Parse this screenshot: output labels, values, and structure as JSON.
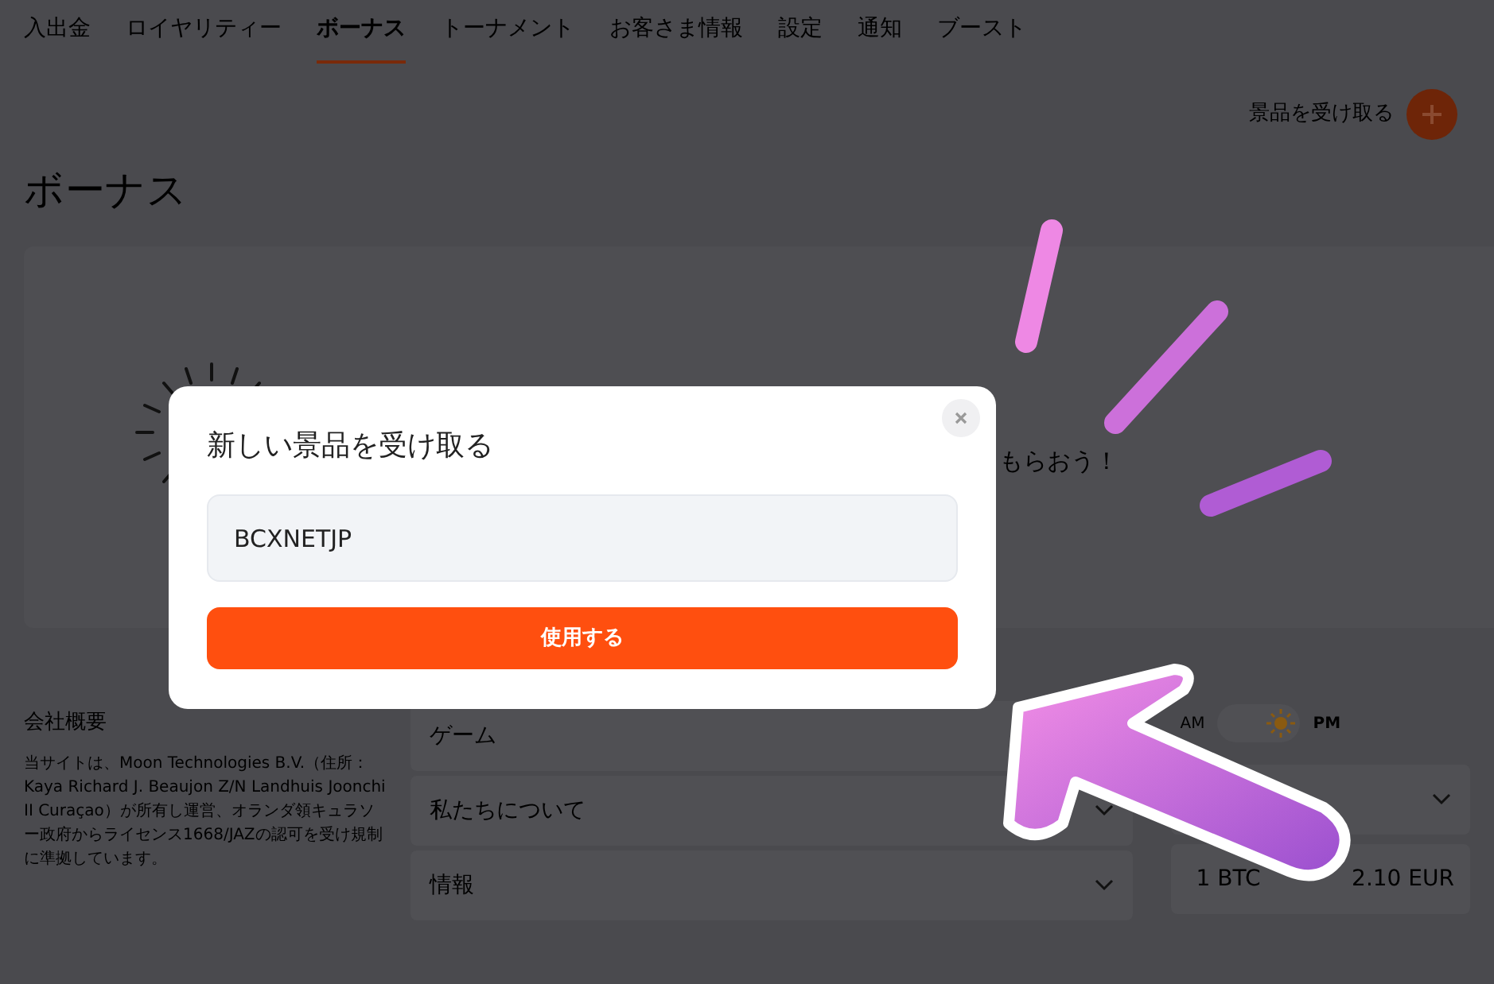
{
  "nav": {
    "tabs": [
      {
        "label": "入出金",
        "selected": false
      },
      {
        "label": "ロイヤリティー",
        "selected": false
      },
      {
        "label": "ボーナス",
        "selected": true
      },
      {
        "label": "トーナメント",
        "selected": false
      },
      {
        "label": "お客さま情報",
        "selected": false
      },
      {
        "label": "設定",
        "selected": false
      },
      {
        "label": "通知",
        "selected": false
      },
      {
        "label": "ブースト",
        "selected": false
      }
    ]
  },
  "claim_link": {
    "label": "景品を受け取る"
  },
  "heading": "ボーナス",
  "card": {
    "text": "もらおう！"
  },
  "footer": {
    "about": {
      "title": "会社概要",
      "text": "当サイトは、Moon Technologies B.V.（住所：Kaya Richard J. Beaujon Z/N Landhuis Joonchi II Curaçao）が所有し運営、オランダ領キュラソー政府からライセンス1668/JAZの認可を受け規制に準拠しています。"
    },
    "accordions": [
      {
        "label": "ゲーム"
      },
      {
        "label": "私たちについて"
      },
      {
        "label": "情報"
      }
    ],
    "time_toggle": {
      "options": [
        {
          "label": "AM",
          "selected": false
        },
        {
          "label": "PM",
          "selected": true
        }
      ]
    },
    "rate": {
      "left": "1 BTC",
      "right": "2.10 EUR"
    }
  },
  "modal": {
    "title": "新しい景品を受け取る",
    "input_value": "BCXNETJP",
    "button": "使用する"
  }
}
